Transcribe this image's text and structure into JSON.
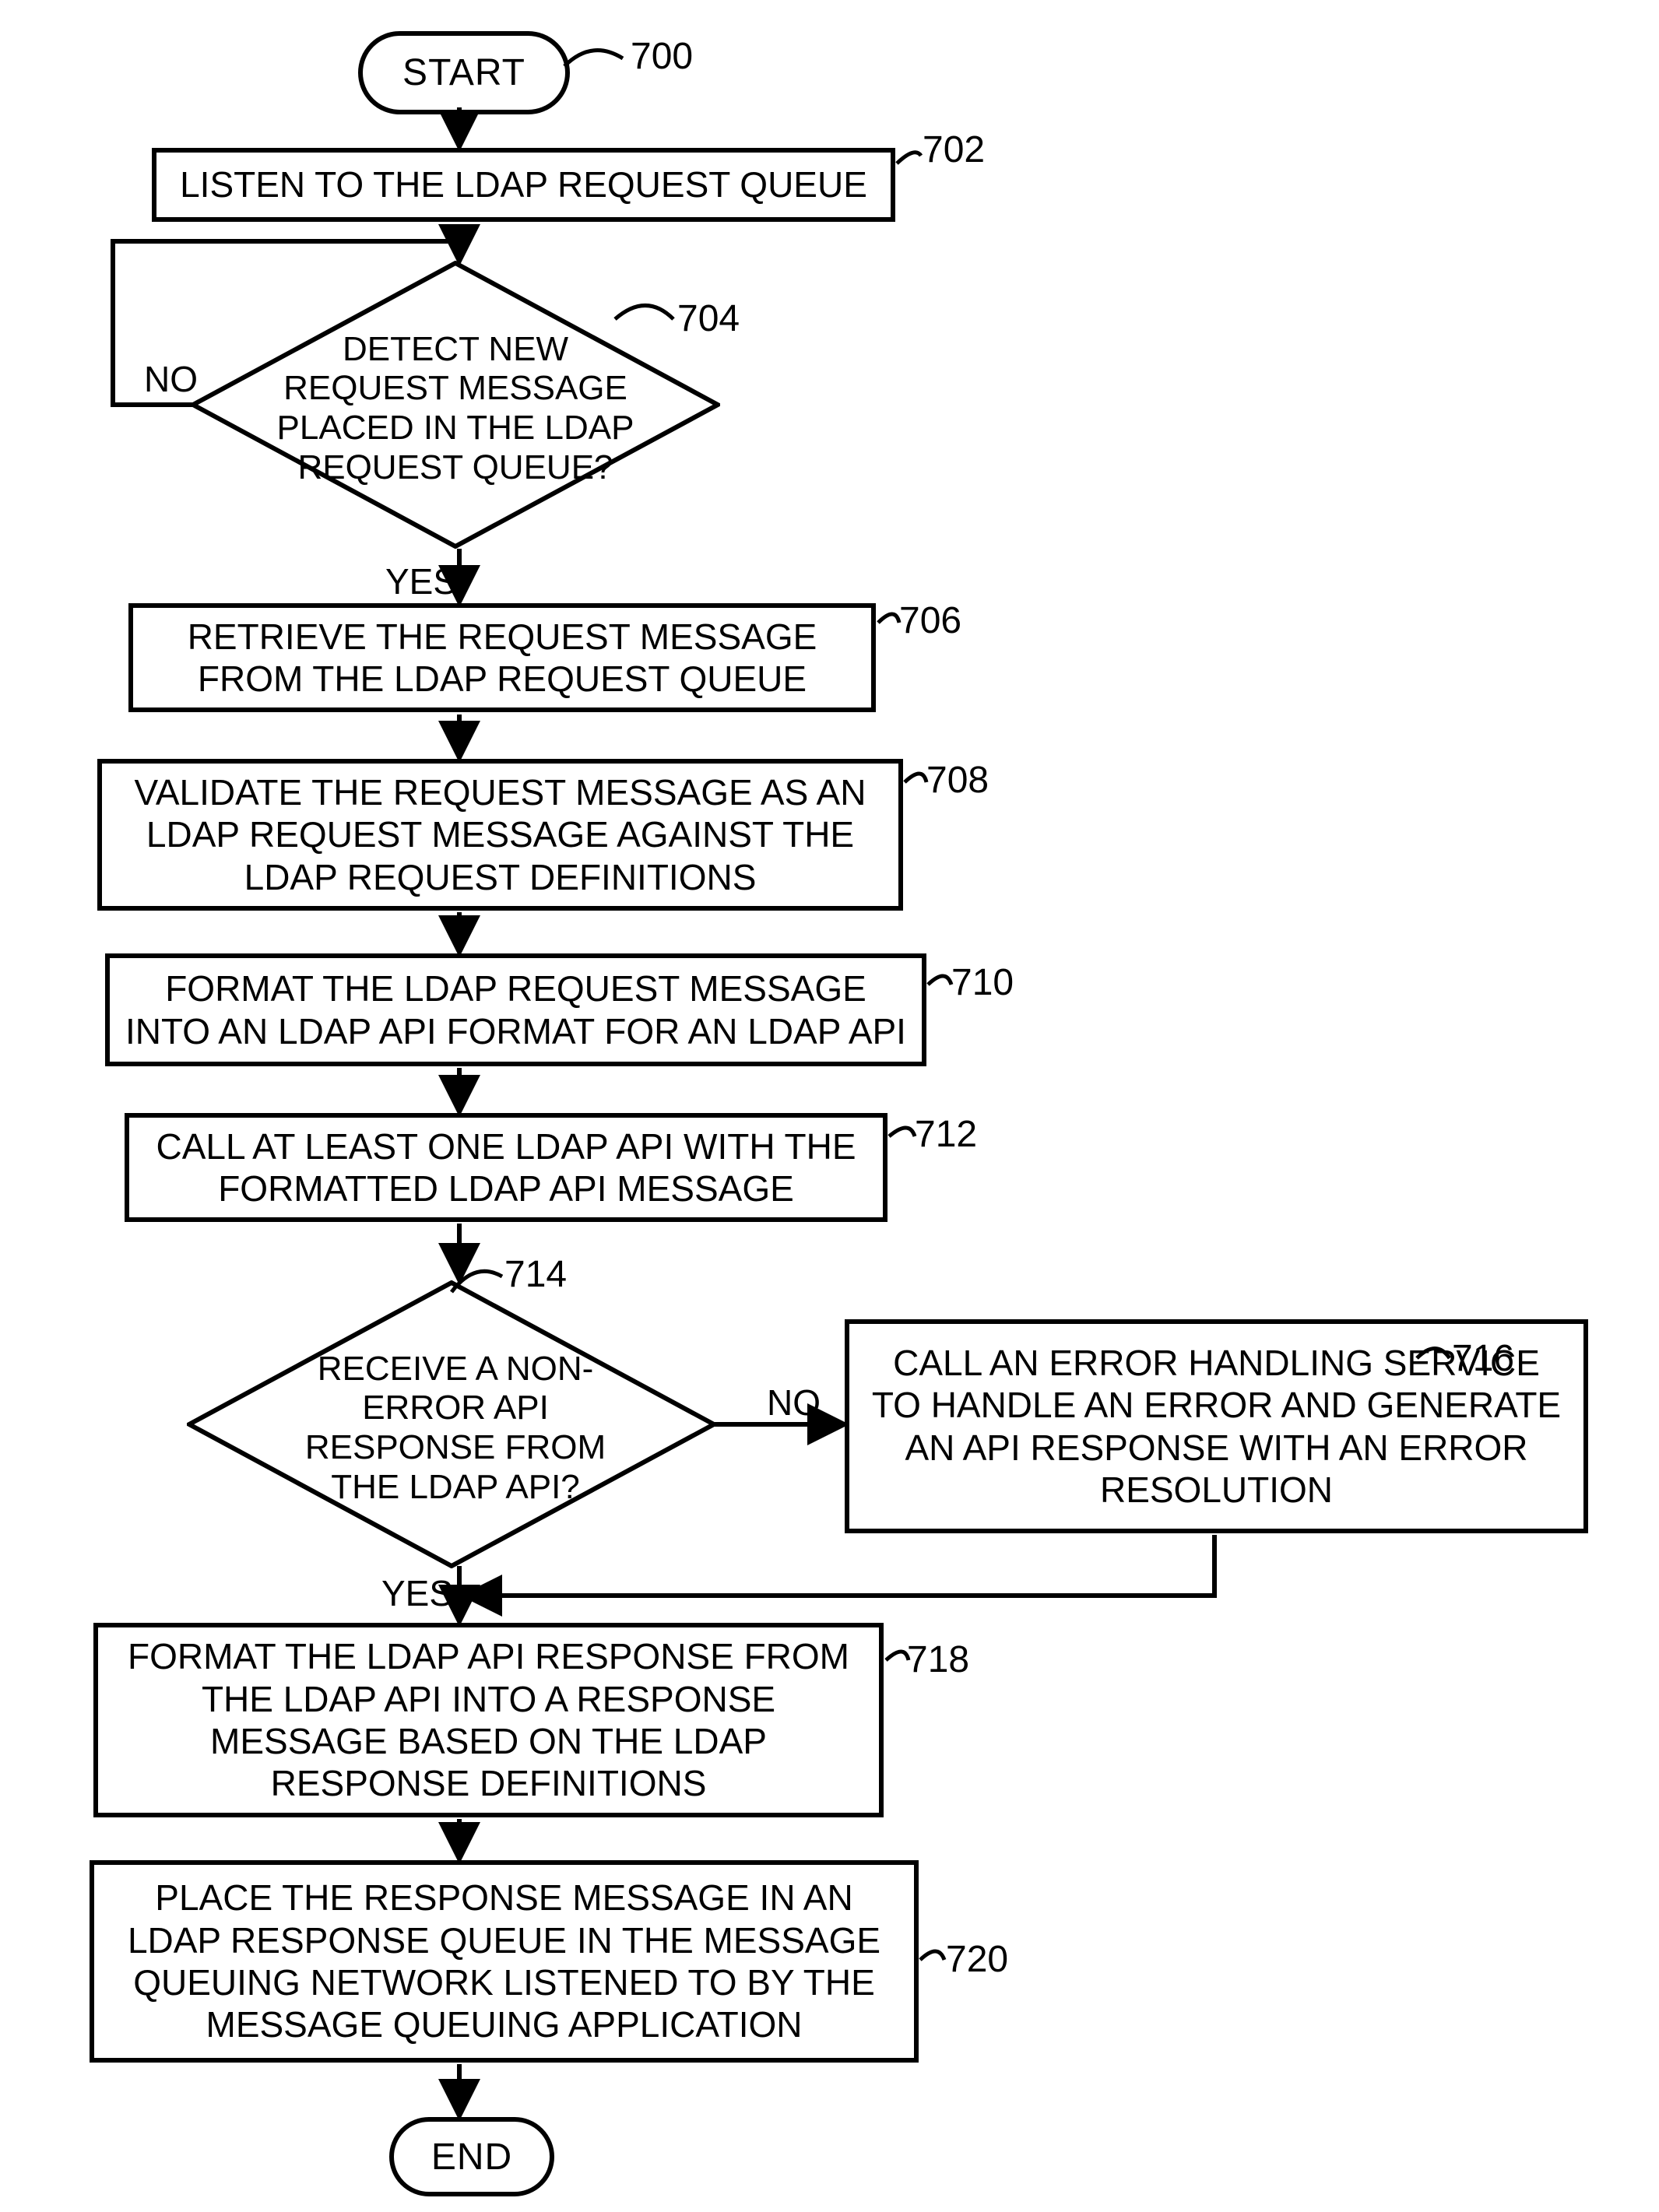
{
  "chart_data": {
    "type": "flowchart",
    "nodes": [
      {
        "id": "start",
        "ref": "700",
        "type": "terminator",
        "text": "START"
      },
      {
        "id": "n702",
        "ref": "702",
        "type": "process",
        "text": "LISTEN TO THE LDAP REQUEST QUEUE"
      },
      {
        "id": "n704",
        "ref": "704",
        "type": "decision",
        "text": "DETECT NEW REQUEST MESSAGE PLACED IN THE LDAP REQUEST QUEUE?"
      },
      {
        "id": "n706",
        "ref": "706",
        "type": "process",
        "text": "RETRIEVE THE REQUEST MESSAGE FROM THE LDAP REQUEST QUEUE"
      },
      {
        "id": "n708",
        "ref": "708",
        "type": "process",
        "text": "VALIDATE THE REQUEST MESSAGE  AS AN LDAP REQUEST MESSAGE AGAINST THE LDAP REQUEST DEFINITIONS"
      },
      {
        "id": "n710",
        "ref": "710",
        "type": "process",
        "text": "FORMAT THE LDAP REQUEST MESSAGE INTO AN LDAP API FORMAT FOR AN LDAP API"
      },
      {
        "id": "n712",
        "ref": "712",
        "type": "process",
        "text": "CALL  AT LEAST ONE LDAP API WITH THE FORMATTED LDAP API MESSAGE"
      },
      {
        "id": "n714",
        "ref": "714",
        "type": "decision",
        "text": "RECEIVE A NON-ERROR API RESPONSE FROM THE LDAP API?"
      },
      {
        "id": "n716",
        "ref": "716",
        "type": "process",
        "text": "CALL AN ERROR HANDLING SERVICE TO HANDLE AN ERROR AND GENERATE AN API RESPONSE WITH AN ERROR RESOLUTION"
      },
      {
        "id": "n718",
        "ref": "718",
        "type": "process",
        "text": "FORMAT THE LDAP API RESPONSE FROM THE LDAP API INTO A RESPONSE MESSAGE BASED ON THE LDAP RESPONSE DEFINITIONS"
      },
      {
        "id": "n720",
        "ref": "720",
        "type": "process",
        "text": "PLACE THE RESPONSE MESSAGE IN AN LDAP RESPONSE QUEUE IN THE MESSAGE QUEUING NETWORK LISTENED TO BY THE MESSAGE QUEUING APPLICATION"
      },
      {
        "id": "end",
        "ref": "",
        "type": "terminator",
        "text": "END"
      }
    ],
    "edges": [
      {
        "from": "start",
        "to": "n702",
        "label": ""
      },
      {
        "from": "n702",
        "to": "n704",
        "label": ""
      },
      {
        "from": "n704",
        "to": "n702",
        "label": "NO"
      },
      {
        "from": "n704",
        "to": "n706",
        "label": "YES"
      },
      {
        "from": "n706",
        "to": "n708",
        "label": ""
      },
      {
        "from": "n708",
        "to": "n710",
        "label": ""
      },
      {
        "from": "n710",
        "to": "n712",
        "label": ""
      },
      {
        "from": "n712",
        "to": "n714",
        "label": ""
      },
      {
        "from": "n714",
        "to": "n716",
        "label": "NO"
      },
      {
        "from": "n714",
        "to": "n718",
        "label": "YES"
      },
      {
        "from": "n716",
        "to": "n718",
        "label": ""
      },
      {
        "from": "n718",
        "to": "n720",
        "label": ""
      },
      {
        "from": "n720",
        "to": "end",
        "label": ""
      }
    ]
  },
  "labels": {
    "no": "NO",
    "yes": "YES"
  },
  "refs": {
    "r700": "700",
    "r702": "702",
    "r704": "704",
    "r706": "706",
    "r708": "708",
    "r710": "710",
    "r712": "712",
    "r714": "714",
    "r716": "716",
    "r718": "718",
    "r720": "720"
  }
}
